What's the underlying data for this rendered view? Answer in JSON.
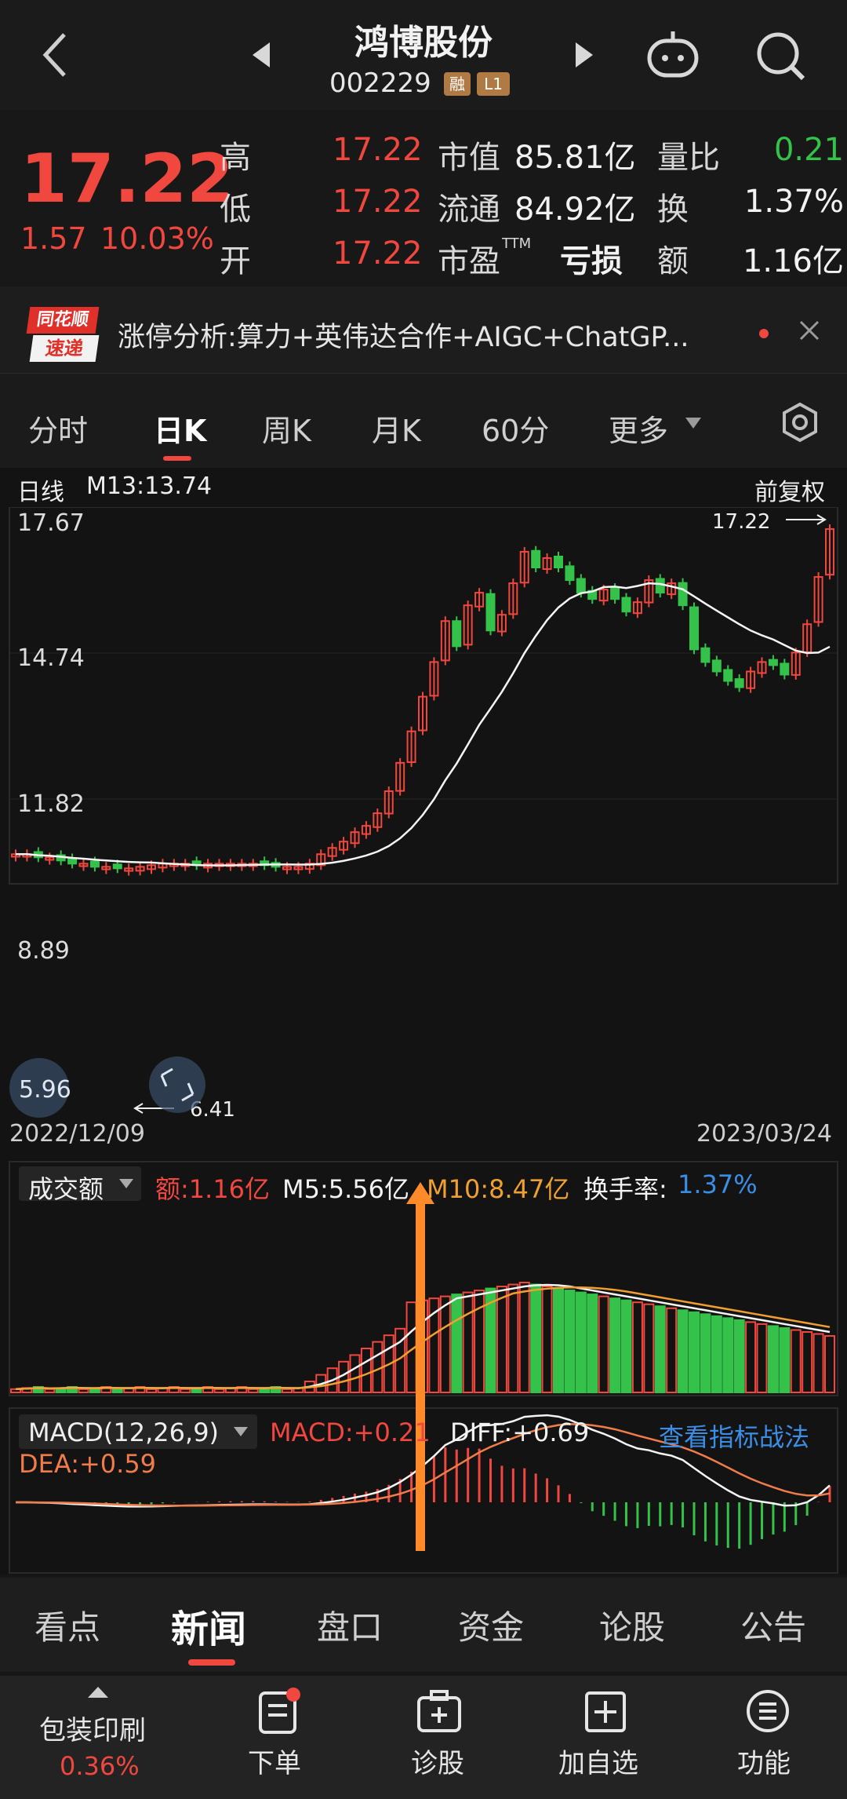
{
  "header": {
    "title": "鸿博股份",
    "code": "002229",
    "badge_margin": "融",
    "badge_level": "L1"
  },
  "quote": {
    "price": "17.22",
    "change": "1.57",
    "change_pct": "10.03%",
    "rows": [
      {
        "l1": "高",
        "v1": "17.22",
        "l2": "市值",
        "v2": "85.81亿",
        "l3": "量比",
        "v3": "0.21"
      },
      {
        "l1": "低",
        "v1": "17.22",
        "l2": "流通",
        "v2": "84.92亿",
        "l3": "换",
        "v3": "1.37%"
      },
      {
        "l1": "开",
        "v1": "17.22",
        "l2": "市盈",
        "l2sup": "TTM",
        "v2": "亏损",
        "l3": "额",
        "v3": "1.16亿"
      }
    ]
  },
  "news": {
    "logo_top": "同花顺",
    "logo_bottom": "速递",
    "text": "涨停分析:算力+英伟达合作+AIGC+ChatGP..."
  },
  "tabs": [
    "分时",
    "日K",
    "周K",
    "月K",
    "60分",
    "更多"
  ],
  "kline": {
    "label": "日线",
    "ma": "M13:13.74",
    "adjust": "前复权",
    "y_ticks": [
      "17.67",
      "14.74",
      "11.82",
      "8.89"
    ],
    "max_label": "17.22",
    "min_label": "6.41",
    "bubble": "5.96",
    "date_start": "2022/12/09",
    "date_end": "2023/03/24"
  },
  "volume": {
    "selector": "成交额",
    "amount": "额:1.16亿",
    "m5": "M5:5.56亿",
    "m10": "M10:8.47亿",
    "turnover_label": "换手率:",
    "turnover": "1.37%"
  },
  "macd": {
    "selector": "MACD(12,26,9)",
    "macd": "MACD:+0.21",
    "diff": "DIFF:+0.69",
    "dea": "DEA:+0.59",
    "link": "查看指标战法"
  },
  "bottom_tabs": [
    "看点",
    "新闻",
    "盘口",
    "资金",
    "论股",
    "公告"
  ],
  "bottom_bar": {
    "sector": "包装印刷",
    "sector_pct": "0.36%",
    "actions": [
      "下单",
      "诊股",
      "加自选",
      "功能"
    ]
  },
  "colors": {
    "up": "#f0473e",
    "down": "#34c24a",
    "accent": "#ff8a2a",
    "link": "#3a8ee6"
  }
}
